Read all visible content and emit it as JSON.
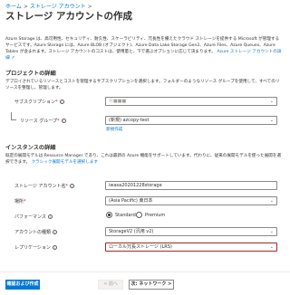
{
  "breadcrumb": [
    "ホーム",
    "ストレージ アカウント"
  ],
  "title": "ストレージ アカウントの作成",
  "intro": {
    "text": "Azure Storage は、高可用性、セキュリティ、耐久性、スケーラビリティ、冗長性を備えたクラウド ストレージを提供する Microsoft が管理するサービスです。Azure Storage には、Azure BLOB (オブジェクト)、Azure Data Lake Storage Gen2、Azure Files、Azure Queues、Azure Tables が含まれます。ストレージ アカウントのコストは、使用量と、下で選ぶオプションに応じて決まります。",
    "link": "Azure ストレージ アカウントの詳細",
    "link_suffix": "↗"
  },
  "project": {
    "heading": "プロジェクトの詳細",
    "description": "デプロイされているリソースとコストを管理するサブスクリプションを選択します。フォルダーのようなリソース グループを使用して、すべてのリソースを整理し、管理します。",
    "subscription_label": "サブスクリプション",
    "subscription_value": "Ⓡ■■■",
    "resource_group_label": "リソース グループ",
    "resource_group_value": "(新規) azcopy-test",
    "new_link": "新規作成"
  },
  "instance": {
    "heading": "インスタンスの詳細",
    "description": "既定の展開モデルは Resource Manager であり、これは最新の Azure 機能をサポートしています。代わりに、従来の展開モデルを使った展開を選択できます。",
    "classic_link": "クラシック展開モデルを選択します",
    "account_name_label": "ストレージ アカウント名",
    "account_name_value": "iwasa20201228storage",
    "location_label": "場所",
    "location_value": "(Asia Pacific) 東日本",
    "performance_label": "パフォーマンス",
    "performance_options": [
      "Standard",
      "Premium"
    ],
    "performance_selected": "Standard",
    "kind_label": "アカウントの種類",
    "kind_value": "StorageV2 (汎用 v2)",
    "replication_label": "レプリケーション",
    "replication_value": "ローカル冗長ストレージ (LRS)"
  },
  "footer": {
    "review_button": "確認および作成",
    "prev_button": "< 前へ",
    "next_button": "次: ネットワーク >"
  },
  "colors": {
    "accent": "#0078d4",
    "required": "#a4262c"
  }
}
